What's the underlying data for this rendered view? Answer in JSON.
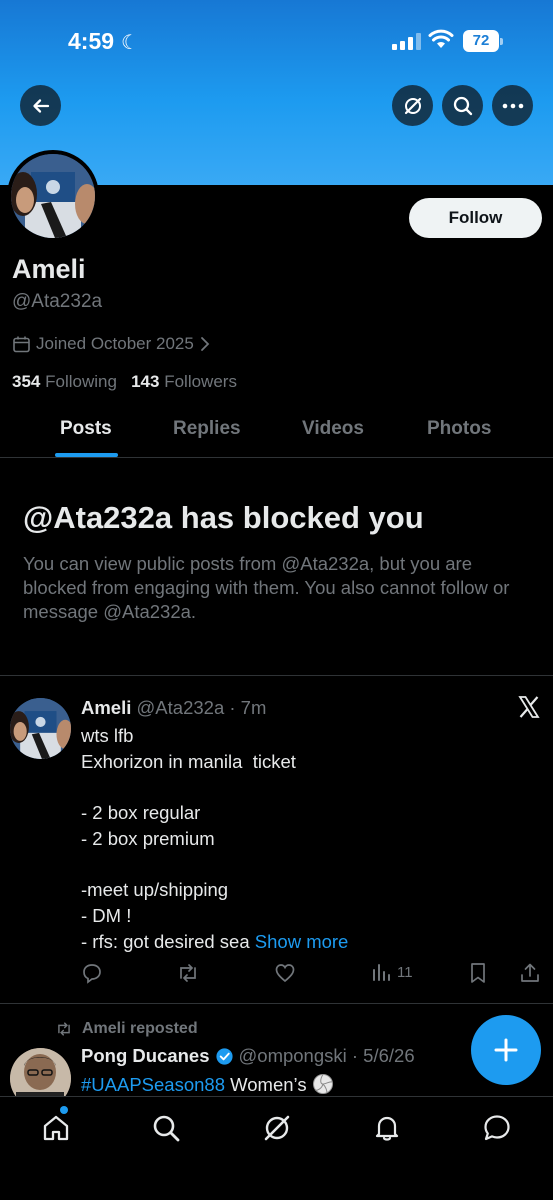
{
  "status_bar": {
    "time": "4:59",
    "battery": "72"
  },
  "profile": {
    "name": "Ameli",
    "handle": "@Ata232a",
    "joined": "Joined October 2025",
    "following_count": "354",
    "following_label": "Following",
    "followers_count": "143",
    "followers_label": "Followers",
    "follow_label": "Follow"
  },
  "tabs": [
    {
      "label": "Posts",
      "active": true
    },
    {
      "label": "Replies",
      "active": false
    },
    {
      "label": "Videos",
      "active": false
    },
    {
      "label": "Photos",
      "active": false
    }
  ],
  "blocked": {
    "title": "@Ata232a has blocked you",
    "message": "You can view public posts from @Ata232a, but you are blocked from engaging with them. You also cannot follow or message @Ata232a."
  },
  "tweet": {
    "author": "Ameli",
    "meta": "@Ata232a · 7m",
    "lines": [
      "wts lfb",
      "Exhorizon in manila  ticket",
      "",
      "- 2 box regular",
      "- 2 box premium",
      "",
      "-meet up/shipping",
      "- DM !",
      "- rfs: got desired sea "
    ],
    "show_more": "Show more",
    "views": "11"
  },
  "repost": {
    "label": "Ameli reposted",
    "author": "Pong Ducanes",
    "meta": "@ompongski · 5/6/26",
    "hashtag": "#UAAPSeason88",
    "text": " Women’s"
  },
  "colors": {
    "accent": "#1d9bf0",
    "banner": "#1d9bf0",
    "background": "#000000",
    "muted": "#71767b"
  }
}
